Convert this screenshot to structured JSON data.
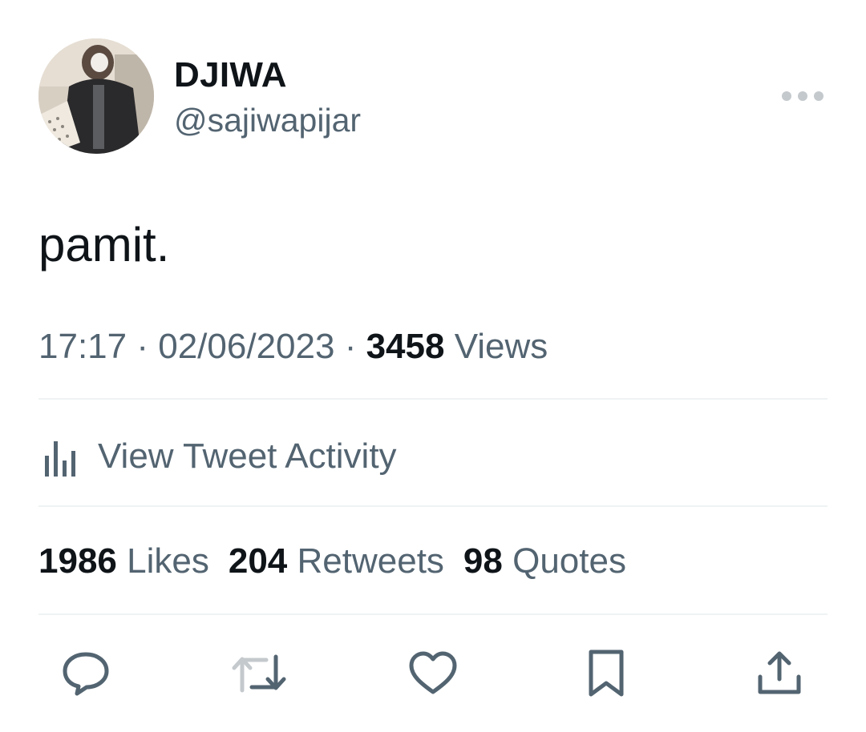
{
  "author": {
    "display_name": "DJIWA",
    "handle": "@sajiwapijar"
  },
  "tweet": {
    "text": "pamit.",
    "time": "17:17",
    "date": "02/06/2023",
    "separator": "·",
    "views_count": "3458",
    "views_label": "Views"
  },
  "activity": {
    "label": "View Tweet Activity"
  },
  "stats": {
    "likes_count": "1986",
    "likes_label": "Likes",
    "retweets_count": "204",
    "retweets_label": "Retweets",
    "quotes_count": "98",
    "quotes_label": "Quotes"
  },
  "actions": [
    {
      "icon": "reply-icon"
    },
    {
      "icon": "retweet-icon"
    },
    {
      "icon": "like-icon"
    },
    {
      "icon": "bookmark-icon"
    },
    {
      "icon": "share-icon"
    }
  ],
  "colors": {
    "text_primary": "#0f1419",
    "text_secondary": "#536471",
    "divider": "#eff3f4",
    "more_dots": "#c4c9cd"
  }
}
